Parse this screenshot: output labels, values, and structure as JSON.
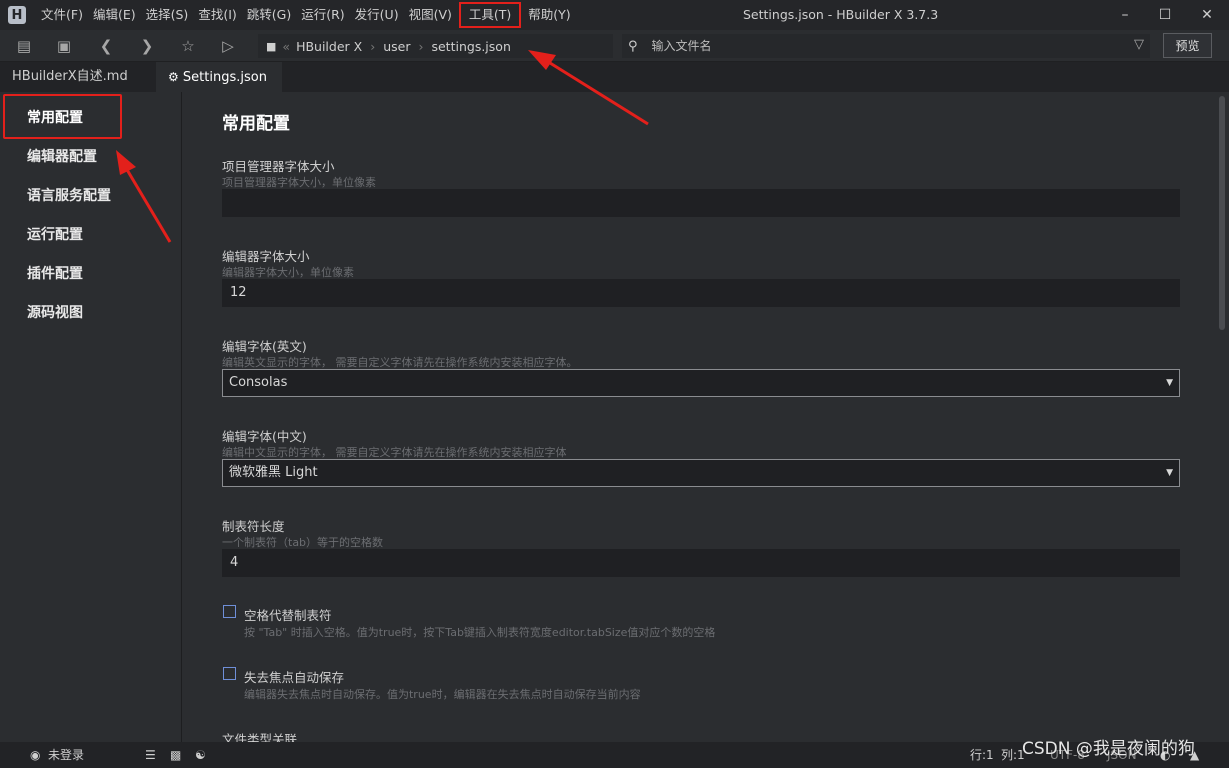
{
  "menu": {
    "items": [
      "文件(F)",
      "编辑(E)",
      "选择(S)",
      "查找(I)",
      "跳转(G)",
      "运行(R)",
      "发行(U)",
      "视图(V)",
      "工具(T)",
      "帮助(Y)"
    ],
    "highlighted_index": 8
  },
  "window": {
    "title": "Settings.json - HBuilder X 3.7.3"
  },
  "breadcrumb": {
    "root": "HBuilder X",
    "folder": "user",
    "file": "settings.json"
  },
  "file_search": {
    "placeholder": "输入文件名"
  },
  "toolbar": {
    "preview_label": "预览"
  },
  "tabs": [
    {
      "label": "HBuilderX自述.md",
      "active": false
    },
    {
      "label": "Settings.json",
      "active": true,
      "icon": "gear-icon"
    }
  ],
  "sidebar": {
    "items": [
      "常用配置",
      "编辑器配置",
      "语言服务配置",
      "运行配置",
      "插件配置",
      "源码视图"
    ],
    "active_index": 0
  },
  "settings": {
    "section_title": "常用配置",
    "fields": [
      {
        "label": "项目管理器字体大小",
        "desc": "项目管理器字体大小，单位像素",
        "value": ""
      },
      {
        "label": "编辑器字体大小",
        "desc": "编辑器字体大小，单位像素",
        "value": "12"
      },
      {
        "label": "编辑字体(英文)",
        "desc": "编辑英文显示的字体， 需要自定义字体请先在操作系统内安装相应字体。",
        "value": "Consolas"
      },
      {
        "label": "编辑字体(中文)",
        "desc": "编辑中文显示的字体， 需要自定义字体请先在操作系统内安装相应字体",
        "value": "微软雅黑 Light"
      },
      {
        "label": "制表符长度",
        "desc": "一个制表符（tab）等于的空格数",
        "value": "4"
      }
    ],
    "checkboxes": [
      {
        "label": "空格代替制表符",
        "desc": "按 \"Tab\" 时插入空格。值为true时，按下Tab键插入制表符宽度editor.tabSize值对应个数的空格",
        "checked": false
      },
      {
        "label": "失去焦点自动保存",
        "desc": "编辑器失去焦点时自动保存。值为true时，编辑器在失去焦点时自动保存当前内容",
        "checked": false
      }
    ],
    "partial_label": "文件类型关联"
  },
  "statusbar": {
    "user": "未登录",
    "row": "行:1",
    "col": "列:1",
    "encoding": "UTF-8",
    "format": "JSON"
  },
  "watermark": "CSDN @我是夜阑的狗",
  "colors": {
    "annotation": "#e3201b",
    "background": "#2b2d30",
    "checkbox_border": "#6f8fd8"
  }
}
